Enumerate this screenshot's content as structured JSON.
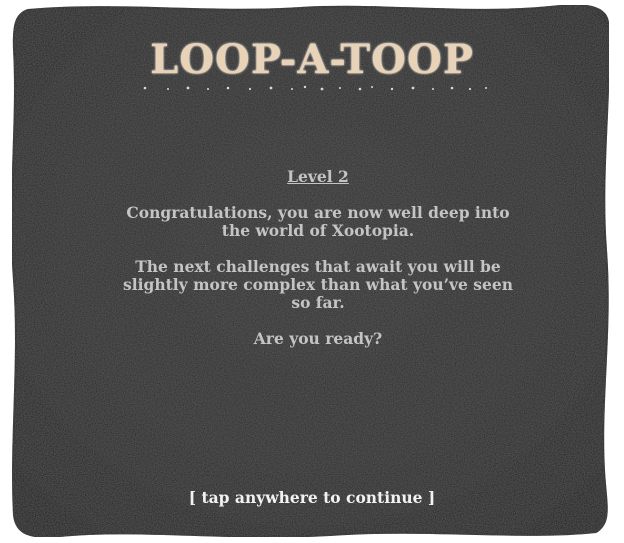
{
  "game": {
    "title": "LOOP-A-TOOP",
    "level_label": "Level 2",
    "message_lines": [
      "Congratulations, you are now well deep into the world of Xootopia.",
      "The next challenges that await you will be slightly more complex than what you’ve seen so far.",
      "Are you ready?"
    ],
    "continue_prompt": "[ tap anywhere to continue ]"
  },
  "colors": {
    "panel": "#232323",
    "panel_edge": "#0d0d0d",
    "title": "#e8d3b8",
    "body_text": "#c4c4c4",
    "prompt_text": "#f2f2f2"
  }
}
